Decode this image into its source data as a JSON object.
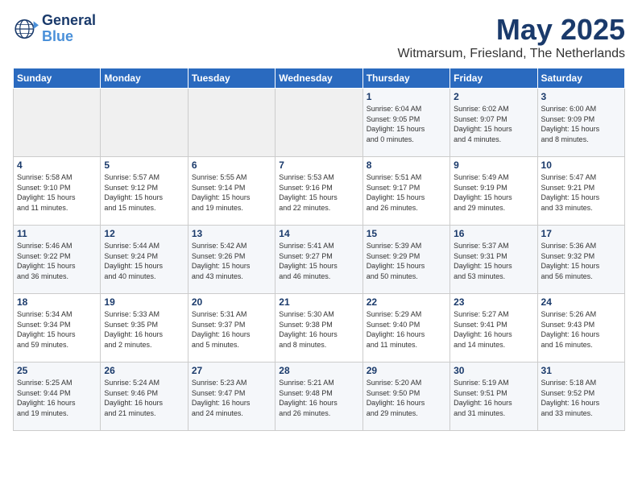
{
  "logo": {
    "line1": "General",
    "line2": "Blue"
  },
  "title": "May 2025",
  "subtitle": "Witmarsum, Friesland, The Netherlands",
  "headers": [
    "Sunday",
    "Monday",
    "Tuesday",
    "Wednesday",
    "Thursday",
    "Friday",
    "Saturday"
  ],
  "weeks": [
    [
      {
        "num": "",
        "info": ""
      },
      {
        "num": "",
        "info": ""
      },
      {
        "num": "",
        "info": ""
      },
      {
        "num": "",
        "info": ""
      },
      {
        "num": "1",
        "info": "Sunrise: 6:04 AM\nSunset: 9:05 PM\nDaylight: 15 hours\nand 0 minutes."
      },
      {
        "num": "2",
        "info": "Sunrise: 6:02 AM\nSunset: 9:07 PM\nDaylight: 15 hours\nand 4 minutes."
      },
      {
        "num": "3",
        "info": "Sunrise: 6:00 AM\nSunset: 9:09 PM\nDaylight: 15 hours\nand 8 minutes."
      }
    ],
    [
      {
        "num": "4",
        "info": "Sunrise: 5:58 AM\nSunset: 9:10 PM\nDaylight: 15 hours\nand 11 minutes."
      },
      {
        "num": "5",
        "info": "Sunrise: 5:57 AM\nSunset: 9:12 PM\nDaylight: 15 hours\nand 15 minutes."
      },
      {
        "num": "6",
        "info": "Sunrise: 5:55 AM\nSunset: 9:14 PM\nDaylight: 15 hours\nand 19 minutes."
      },
      {
        "num": "7",
        "info": "Sunrise: 5:53 AM\nSunset: 9:16 PM\nDaylight: 15 hours\nand 22 minutes."
      },
      {
        "num": "8",
        "info": "Sunrise: 5:51 AM\nSunset: 9:17 PM\nDaylight: 15 hours\nand 26 minutes."
      },
      {
        "num": "9",
        "info": "Sunrise: 5:49 AM\nSunset: 9:19 PM\nDaylight: 15 hours\nand 29 minutes."
      },
      {
        "num": "10",
        "info": "Sunrise: 5:47 AM\nSunset: 9:21 PM\nDaylight: 15 hours\nand 33 minutes."
      }
    ],
    [
      {
        "num": "11",
        "info": "Sunrise: 5:46 AM\nSunset: 9:22 PM\nDaylight: 15 hours\nand 36 minutes."
      },
      {
        "num": "12",
        "info": "Sunrise: 5:44 AM\nSunset: 9:24 PM\nDaylight: 15 hours\nand 40 minutes."
      },
      {
        "num": "13",
        "info": "Sunrise: 5:42 AM\nSunset: 9:26 PM\nDaylight: 15 hours\nand 43 minutes."
      },
      {
        "num": "14",
        "info": "Sunrise: 5:41 AM\nSunset: 9:27 PM\nDaylight: 15 hours\nand 46 minutes."
      },
      {
        "num": "15",
        "info": "Sunrise: 5:39 AM\nSunset: 9:29 PM\nDaylight: 15 hours\nand 50 minutes."
      },
      {
        "num": "16",
        "info": "Sunrise: 5:37 AM\nSunset: 9:31 PM\nDaylight: 15 hours\nand 53 minutes."
      },
      {
        "num": "17",
        "info": "Sunrise: 5:36 AM\nSunset: 9:32 PM\nDaylight: 15 hours\nand 56 minutes."
      }
    ],
    [
      {
        "num": "18",
        "info": "Sunrise: 5:34 AM\nSunset: 9:34 PM\nDaylight: 15 hours\nand 59 minutes."
      },
      {
        "num": "19",
        "info": "Sunrise: 5:33 AM\nSunset: 9:35 PM\nDaylight: 16 hours\nand 2 minutes."
      },
      {
        "num": "20",
        "info": "Sunrise: 5:31 AM\nSunset: 9:37 PM\nDaylight: 16 hours\nand 5 minutes."
      },
      {
        "num": "21",
        "info": "Sunrise: 5:30 AM\nSunset: 9:38 PM\nDaylight: 16 hours\nand 8 minutes."
      },
      {
        "num": "22",
        "info": "Sunrise: 5:29 AM\nSunset: 9:40 PM\nDaylight: 16 hours\nand 11 minutes."
      },
      {
        "num": "23",
        "info": "Sunrise: 5:27 AM\nSunset: 9:41 PM\nDaylight: 16 hours\nand 14 minutes."
      },
      {
        "num": "24",
        "info": "Sunrise: 5:26 AM\nSunset: 9:43 PM\nDaylight: 16 hours\nand 16 minutes."
      }
    ],
    [
      {
        "num": "25",
        "info": "Sunrise: 5:25 AM\nSunset: 9:44 PM\nDaylight: 16 hours\nand 19 minutes."
      },
      {
        "num": "26",
        "info": "Sunrise: 5:24 AM\nSunset: 9:46 PM\nDaylight: 16 hours\nand 21 minutes."
      },
      {
        "num": "27",
        "info": "Sunrise: 5:23 AM\nSunset: 9:47 PM\nDaylight: 16 hours\nand 24 minutes."
      },
      {
        "num": "28",
        "info": "Sunrise: 5:21 AM\nSunset: 9:48 PM\nDaylight: 16 hours\nand 26 minutes."
      },
      {
        "num": "29",
        "info": "Sunrise: 5:20 AM\nSunset: 9:50 PM\nDaylight: 16 hours\nand 29 minutes."
      },
      {
        "num": "30",
        "info": "Sunrise: 5:19 AM\nSunset: 9:51 PM\nDaylight: 16 hours\nand 31 minutes."
      },
      {
        "num": "31",
        "info": "Sunrise: 5:18 AM\nSunset: 9:52 PM\nDaylight: 16 hours\nand 33 minutes."
      }
    ]
  ]
}
